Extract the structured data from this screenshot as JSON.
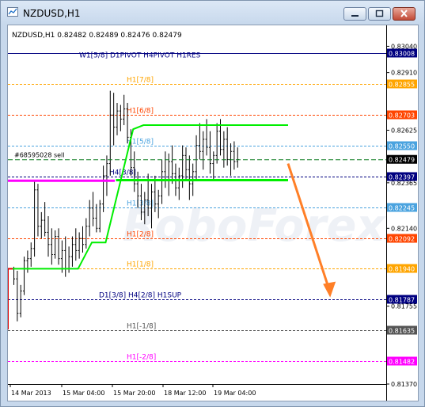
{
  "window": {
    "title": "NZDUSD,H1",
    "minimize_label": "minimize",
    "maximize_label": "maximize",
    "close_label": "close"
  },
  "chart_header": "NZDUSD,H1  0.82482 0.82489 0.82476 0.82479",
  "watermark": "RoboForex",
  "colors": {
    "window_bg": "#c7d8ec",
    "chart_bg": "#ffffff",
    "candle": "#000000",
    "green_line": "#00ff00",
    "magenta_line": "#ff00ff",
    "arrow": "#ff7f27",
    "current_price_box": "#000080"
  },
  "chart_data": {
    "type": "candlestick",
    "symbol": "NZDUSD",
    "timeframe": "H1",
    "ohlc_last": {
      "open": 0.82482,
      "high": 0.82489,
      "low": 0.82476,
      "close": 0.82479
    },
    "x_tick_labels": [
      "14 Mar 2013",
      "15 Mar 04:00",
      "15 Mar 20:00",
      "18 Mar 12:00",
      "19 Mar 04:00"
    ],
    "y_tick_labels": [
      "0.83040",
      "0.82910",
      "0.82625",
      "0.82365",
      "0.82140",
      "0.81755",
      "0.81370"
    ],
    "ylim": [
      0.8137,
      0.8312
    ],
    "murrey_levels": [
      {
        "label": "W1[5/8] D1PIVOT H4PIVOT H1RES",
        "price": "0.83008",
        "color": "#000080",
        "box_color": "#000080",
        "style": "solid"
      },
      {
        "label": "H1[7/8]",
        "price": "0.82855",
        "color": "#ffa500",
        "box_color": "#ffa500",
        "style": "dash"
      },
      {
        "label": "H1[6/8]",
        "price": "0.82703",
        "color": "#ff4500",
        "box_color": "#ff4500",
        "style": "dash"
      },
      {
        "label": "H1[5/8]",
        "price": "0.82550",
        "color": "#4aa3df",
        "box_color": "#4aa3df",
        "style": "dash"
      },
      {
        "label": "H4[3/8]",
        "price": "0.82397",
        "color": "#000080",
        "box_color": "#000080",
        "style": "dash"
      },
      {
        "label": "H1[3/8]",
        "price": "0.82245",
        "color": "#4aa3df",
        "box_color": "#4aa3df",
        "style": "dash"
      },
      {
        "label": "H1[2/8]",
        "price": "0.82092",
        "color": "#ff4500",
        "box_color": "#ff4500",
        "style": "dash"
      },
      {
        "label": "H1[1/8]",
        "price": "0.81940",
        "color": "#ffa500",
        "box_color": "#ffa500",
        "style": "dash"
      },
      {
        "label": "D1[3/8] H4[2/8] H1SUP",
        "price": "0.81787",
        "color": "#000080",
        "box_color": "#000080",
        "style": "dash"
      },
      {
        "label": "H1[-1/8]",
        "price": "0.81635",
        "color": "#555555",
        "box_color": "#555555",
        "style": "dash"
      },
      {
        "label": "H1[-2/8]",
        "price": "0.81482",
        "color": "#ff00ff",
        "box_color": "#ff00ff",
        "style": "dash"
      }
    ],
    "current_price": "0.82479",
    "order_line": {
      "label": "#68595028 sell",
      "price": 0.82479
    },
    "magenta_level": 0.82375,
    "green_trailing_line": [
      {
        "i": 0,
        "p": 0.8194
      },
      {
        "i": 19,
        "p": 0.8194
      },
      {
        "i": 23,
        "p": 0.8207
      },
      {
        "i": 27,
        "p": 0.8207
      },
      {
        "i": 31,
        "p": 0.8235
      },
      {
        "i": 35,
        "p": 0.8263
      },
      {
        "i": 38,
        "p": 0.8265
      },
      {
        "i": 80,
        "p": 0.8265
      }
    ],
    "green_lower_line": [
      {
        "i": 30,
        "p": 0.82378
      },
      {
        "i": 80,
        "p": 0.82378
      }
    ],
    "forecast_arrow": {
      "from": {
        "i": 80,
        "p": 0.8246
      },
      "to": {
        "i": 92,
        "p": 0.8181
      }
    },
    "candles": [
      [
        0.8194,
        0.8195,
        0.8186,
        0.8189
      ],
      [
        0.8189,
        0.8193,
        0.8168,
        0.8172
      ],
      [
        0.8172,
        0.8186,
        0.817,
        0.8183
      ],
      [
        0.8183,
        0.82,
        0.8181,
        0.8198
      ],
      [
        0.8198,
        0.8203,
        0.8192,
        0.8199
      ],
      [
        0.8199,
        0.8207,
        0.8195,
        0.8204
      ],
      [
        0.8204,
        0.8238,
        0.82,
        0.8233
      ],
      [
        0.8233,
        0.8236,
        0.821,
        0.8215
      ],
      [
        0.8215,
        0.8222,
        0.8209,
        0.8218
      ],
      [
        0.8218,
        0.8227,
        0.821,
        0.8212
      ],
      [
        0.8212,
        0.822,
        0.82,
        0.8206
      ],
      [
        0.8206,
        0.8214,
        0.8196,
        0.8201
      ],
      [
        0.8201,
        0.8213,
        0.8199,
        0.821
      ],
      [
        0.821,
        0.8214,
        0.8196,
        0.8199
      ],
      [
        0.8199,
        0.8208,
        0.8192,
        0.8203
      ],
      [
        0.8203,
        0.821,
        0.819,
        0.8194
      ],
      [
        0.8194,
        0.8205,
        0.8192,
        0.82
      ],
      [
        0.82,
        0.821,
        0.8195,
        0.8206
      ],
      [
        0.8206,
        0.8214,
        0.8198,
        0.8203
      ],
      [
        0.8203,
        0.8212,
        0.8199,
        0.8209
      ],
      [
        0.8209,
        0.8215,
        0.8202,
        0.8206
      ],
      [
        0.8206,
        0.8219,
        0.8204,
        0.8215
      ],
      [
        0.8215,
        0.8228,
        0.821,
        0.8224
      ],
      [
        0.8224,
        0.8232,
        0.8215,
        0.8219
      ],
      [
        0.8219,
        0.8226,
        0.8212,
        0.8214
      ],
      [
        0.8214,
        0.8228,
        0.8212,
        0.8226
      ],
      [
        0.8226,
        0.8245,
        0.8222,
        0.824
      ],
      [
        0.824,
        0.825,
        0.823,
        0.8246
      ],
      [
        0.8246,
        0.8282,
        0.824,
        0.827
      ],
      [
        0.827,
        0.8281,
        0.8255,
        0.8264
      ],
      [
        0.8264,
        0.8276,
        0.826,
        0.8272
      ],
      [
        0.8272,
        0.8275,
        0.8262,
        0.8268
      ],
      [
        0.8268,
        0.828,
        0.8265,
        0.8273
      ],
      [
        0.8273,
        0.8276,
        0.8256,
        0.8259
      ],
      [
        0.8259,
        0.8263,
        0.824,
        0.8244
      ],
      [
        0.8244,
        0.8252,
        0.8232,
        0.8236
      ],
      [
        0.8236,
        0.8242,
        0.8224,
        0.823
      ],
      [
        0.823,
        0.8236,
        0.8218,
        0.8222
      ],
      [
        0.8222,
        0.8232,
        0.8216,
        0.8228
      ],
      [
        0.8228,
        0.8241,
        0.822,
        0.8224
      ],
      [
        0.8224,
        0.8236,
        0.8214,
        0.8232
      ],
      [
        0.8232,
        0.824,
        0.8222,
        0.8226
      ],
      [
        0.8226,
        0.8233,
        0.8219,
        0.823
      ],
      [
        0.823,
        0.8248,
        0.8226,
        0.8242
      ],
      [
        0.8242,
        0.8252,
        0.8234,
        0.8238
      ],
      [
        0.8238,
        0.8251,
        0.823,
        0.8247
      ],
      [
        0.8247,
        0.8255,
        0.8236,
        0.8241
      ],
      [
        0.8241,
        0.8246,
        0.823,
        0.8234
      ],
      [
        0.8234,
        0.8244,
        0.8228,
        0.824
      ],
      [
        0.824,
        0.8255,
        0.8234,
        0.825
      ],
      [
        0.825,
        0.8254,
        0.8238,
        0.8243
      ],
      [
        0.8243,
        0.825,
        0.8228,
        0.8236
      ],
      [
        0.8236,
        0.8246,
        0.823,
        0.8242
      ],
      [
        0.8242,
        0.826,
        0.8238,
        0.8255
      ],
      [
        0.8255,
        0.8266,
        0.8248,
        0.8252
      ],
      [
        0.8252,
        0.8262,
        0.8243,
        0.8258
      ],
      [
        0.8258,
        0.8268,
        0.825,
        0.8254
      ],
      [
        0.8254,
        0.8262,
        0.8241,
        0.8246
      ],
      [
        0.8246,
        0.8252,
        0.8238,
        0.825
      ],
      [
        0.825,
        0.8266,
        0.8246,
        0.8262
      ],
      [
        0.8262,
        0.8268,
        0.825,
        0.8253
      ],
      [
        0.8253,
        0.8262,
        0.8244,
        0.8258
      ],
      [
        0.8258,
        0.8264,
        0.8245,
        0.8248
      ],
      [
        0.8248,
        0.8256,
        0.824,
        0.8252
      ],
      [
        0.8252,
        0.8257,
        0.8243,
        0.8247
      ],
      [
        0.8247,
        0.8254,
        0.8244,
        0.8248
      ]
    ]
  }
}
